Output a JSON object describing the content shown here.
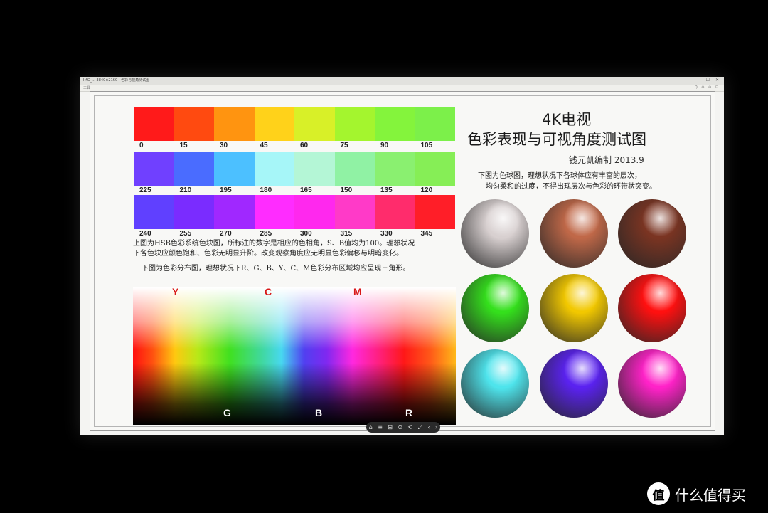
{
  "window": {
    "title": "IMG_... 3840×2160 - 色彩与视角测试图",
    "toolbar_left": "工具",
    "toolbar_right": "Q ⊕ ⊖ ⊡",
    "controls": "— ☐ ✕"
  },
  "chart": {
    "title_line1": "4K电视",
    "title_line2": "色彩表现与可视角度测试图",
    "author": "钱元凯编制 2013.9",
    "sphere_desc_line1": "下图为色球图，理想状况下各球体应有丰富的层次，",
    "sphere_desc_line2": "均匀柔和的过度，不得出现层次与色彩的环带状突变。",
    "hue_desc_line1": "上图为HSB色彩系统色块图，所标注的数字是相应的色相角，S、B值均为100。理想状况",
    "hue_desc_line2": "下各色块应颜色饱和、色彩无明显升阶。改变观察角度应无明显色彩偏移与明暗变化。",
    "gamut_desc": "下图为色彩分布图，理想状况下R、G、B、Y、C、M色彩分布区域均应呈现三角形。",
    "hue_rows": [
      {
        "labels": [
          "0",
          "15",
          "30",
          "45",
          "60",
          "75",
          "90",
          "105"
        ],
        "colors": [
          "#ff1a1a",
          "#ff4a10",
          "#ff9410",
          "#ffd21a",
          "#d8f028",
          "#a4f52e",
          "#84f43c",
          "#7cf04a"
        ]
      },
      {
        "labels": [
          "225",
          "210",
          "195",
          "180",
          "165",
          "150",
          "135",
          "120"
        ],
        "colors": [
          "#7040ff",
          "#4a6cff",
          "#4cc0ff",
          "#a6f6f8",
          "#b4f6d6",
          "#90f2a4",
          "#8af070",
          "#86ee56"
        ]
      },
      {
        "labels": [
          "240",
          "255",
          "270",
          "285",
          "300",
          "315",
          "330",
          "345"
        ],
        "colors": [
          "#6040ff",
          "#7a2cff",
          "#a028ff",
          "#ff2cff",
          "#ff28ee",
          "#ff3ac8",
          "#ff2c6c",
          "#ff1e28"
        ]
      }
    ],
    "gamut_labels_top": [
      "Y",
      "C",
      "M"
    ],
    "gamut_labels_bottom": [
      "G",
      "B",
      "R"
    ],
    "gamut_label_colors": {
      "Y": "#d81818",
      "C": "#d81818",
      "M": "#d81818",
      "G": "#ffffff",
      "B": "#ffffff",
      "R": "#ffffff"
    },
    "spheres": [
      {
        "name": "white",
        "color": "#d8d0d0"
      },
      {
        "name": "skin-light",
        "color": "#c06848"
      },
      {
        "name": "skin-dark",
        "color": "#7a3422"
      },
      {
        "name": "green",
        "color": "#34e01c"
      },
      {
        "name": "yellow",
        "color": "#f2c800"
      },
      {
        "name": "red",
        "color": "#ff1010"
      },
      {
        "name": "cyan",
        "color": "#4ee4ec"
      },
      {
        "name": "blue",
        "color": "#5a22f0"
      },
      {
        "name": "magenta",
        "color": "#ff22c8"
      }
    ]
  },
  "viewer": {
    "controls": [
      "⌂",
      "≡",
      "⊞",
      "⊙",
      "⟲",
      "⤢",
      "‹",
      "›"
    ]
  },
  "watermark": {
    "logo": "值",
    "text": "什么值得买"
  }
}
